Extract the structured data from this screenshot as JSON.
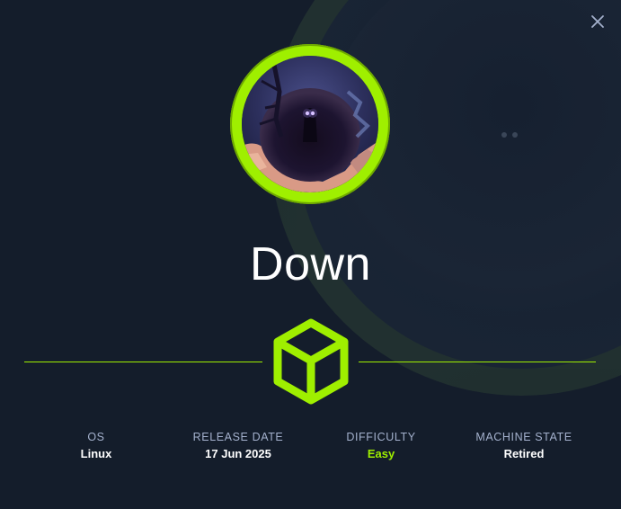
{
  "machine": {
    "name": "Down"
  },
  "stats": [
    {
      "label": "OS",
      "value": "Linux"
    },
    {
      "label": "RELEASE DATE",
      "value": "17 Jun 2025"
    },
    {
      "label": "DIFFICULTY",
      "value": "Easy"
    },
    {
      "label": "MACHINE STATE",
      "value": "Retired"
    }
  ],
  "icons": {
    "close": "close-icon",
    "difficulty": "cube-icon",
    "avatar": "machine-avatar"
  },
  "colors": {
    "background": "#141d2b",
    "accent": "#9fef00",
    "label": "#a4b1cd",
    "text": "#ffffff"
  }
}
